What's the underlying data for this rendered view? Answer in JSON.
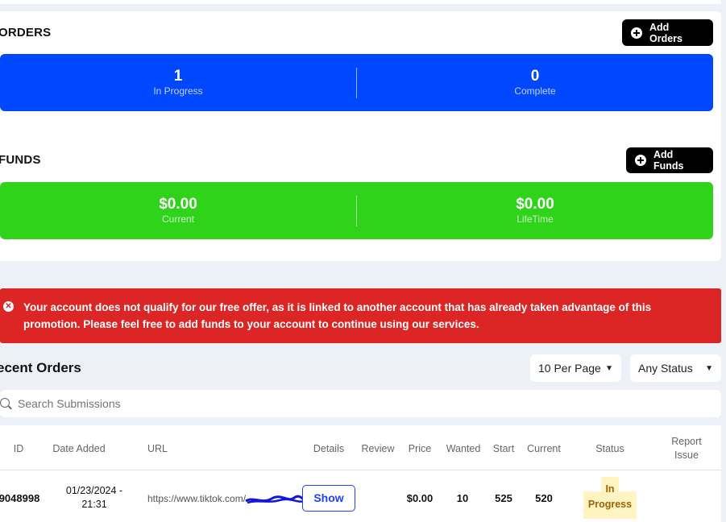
{
  "orders": {
    "title": "ORDERS",
    "add_label": "Add Orders",
    "in_progress_value": "1",
    "in_progress_label": "In Progress",
    "complete_value": "0",
    "complete_label": "Complete"
  },
  "funds": {
    "title": "FUNDS",
    "add_label": "Add Funds",
    "current_value": "$0.00",
    "current_label": "Current",
    "lifetime_value": "$0.00",
    "lifetime_label": "LifeTime"
  },
  "alert": {
    "message": "Your account does not qualify for our free offer, as it is linked to another account that has already taken advantage of this promotion. Please feel free to add funds to your account to continue using our services."
  },
  "recent": {
    "title": "ecent Orders",
    "per_page": "10 Per Page",
    "status_filter": "Any Status",
    "search_placeholder": "Search Submissions"
  },
  "table": {
    "headers": {
      "id": "ID",
      "date": "Date Added",
      "url": "URL",
      "details": "Details",
      "review": "Review",
      "price": "Price",
      "wanted": "Wanted",
      "start": "Start",
      "current": "Current",
      "status": "Status",
      "report": "Report Issue"
    },
    "rows": [
      {
        "id": "9048998",
        "date_line1": "01/23/2024 -",
        "date_line2": "21:31",
        "url": "https://www.tiktok.com/",
        "details": "Show",
        "price": "$0.00",
        "wanted": "10",
        "start": "525",
        "current": "520",
        "status_line1": "In",
        "status_line2": "Progress"
      }
    ]
  },
  "colors": {
    "orders_bar": "#0048ff",
    "funds_bar": "#2fd319",
    "alert": "#dc2626",
    "show_button": "#1e40ff",
    "status_badge": "#fff4c2"
  }
}
